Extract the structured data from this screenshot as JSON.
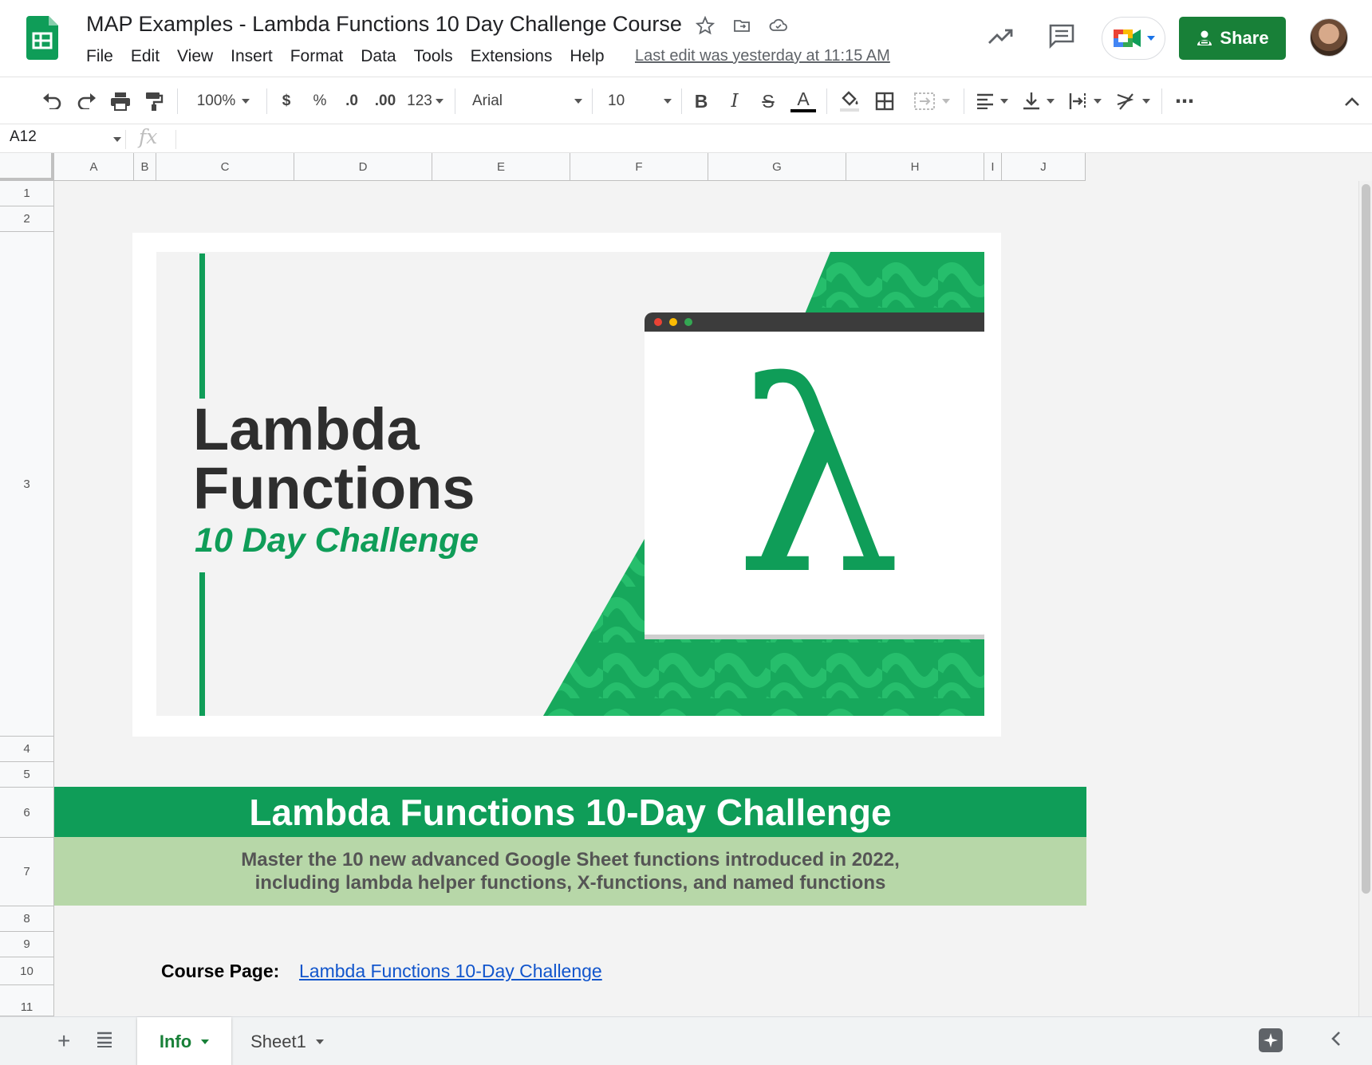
{
  "app": {
    "title": "MAP Examples - Lambda Functions 10 Day Challenge Course",
    "last_edit": "Last edit was yesterday at 11:15 AM",
    "share_label": "Share",
    "brand_green": "#188038"
  },
  "menu": [
    "File",
    "Edit",
    "View",
    "Insert",
    "Format",
    "Data",
    "Tools",
    "Extensions",
    "Help"
  ],
  "toolbar": {
    "zoom": "100%",
    "currency": "$",
    "percent": "%",
    "dec_decrease": ".0",
    "dec_increase": ".00",
    "more_formats": "123",
    "font": "Arial",
    "font_size": "10",
    "bold": "B",
    "italic": "I",
    "strike": "S",
    "text_color": "A",
    "more": "⋯"
  },
  "formula_bar": {
    "cell_ref": "A12",
    "fx": "fx",
    "value": ""
  },
  "columns": [
    "A",
    "B",
    "C",
    "D",
    "E",
    "F",
    "G",
    "H",
    "I",
    "J"
  ],
  "rows": [
    "1",
    "2",
    "3",
    "4",
    "5",
    "6",
    "7",
    "8",
    "9",
    "10",
    "11"
  ],
  "banner": {
    "line1": "Lambda",
    "line2": "Functions",
    "line3": "10 Day Challenge",
    "symbol": "λ",
    "green": "#0f9d58"
  },
  "sheet": {
    "title": "Lambda Functions 10-Day Challenge",
    "subtitle_line1": "Master the 10 new advanced Google Sheet functions introduced in 2022,",
    "subtitle_line2": "including lambda helper functions, X-functions, and named functions",
    "course_label": "Course Page:",
    "course_link": "Lambda Functions 10-Day Challenge",
    "title_bg": "#0f9d58",
    "subtitle_bg": "#b7d7a8"
  },
  "tabs": [
    {
      "label": "Info",
      "active": true
    },
    {
      "label": "Sheet1",
      "active": false
    }
  ]
}
